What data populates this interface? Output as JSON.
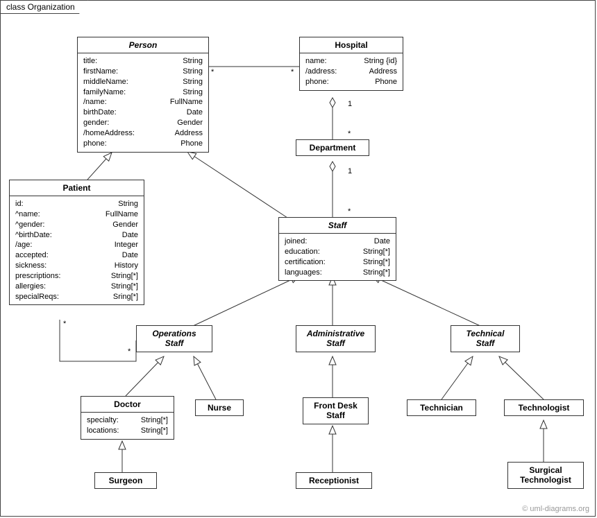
{
  "frame": {
    "title": "class Organization"
  },
  "classes": {
    "person": {
      "name": "Person",
      "attrs": [
        [
          "title:",
          "String"
        ],
        [
          "firstName:",
          "String"
        ],
        [
          "middleName:",
          "String"
        ],
        [
          "familyName:",
          "String"
        ],
        [
          "/name:",
          "FullName"
        ],
        [
          "birthDate:",
          "Date"
        ],
        [
          "gender:",
          "Gender"
        ],
        [
          "/homeAddress:",
          "Address"
        ],
        [
          "phone:",
          "Phone"
        ]
      ]
    },
    "hospital": {
      "name": "Hospital",
      "attrs": [
        [
          "name:",
          "String {id}"
        ],
        [
          "/address:",
          "Address"
        ],
        [
          "phone:",
          "Phone"
        ]
      ]
    },
    "department": {
      "name": "Department"
    },
    "patient": {
      "name": "Patient",
      "attrs": [
        [
          "id:",
          "String"
        ],
        [
          "^name:",
          "FullName"
        ],
        [
          "^gender:",
          "Gender"
        ],
        [
          "^birthDate:",
          "Date"
        ],
        [
          "/age:",
          "Integer"
        ],
        [
          "accepted:",
          "Date"
        ],
        [
          "sickness:",
          "History"
        ],
        [
          "prescriptions:",
          "String[*]"
        ],
        [
          "allergies:",
          "String[*]"
        ],
        [
          "specialReqs:",
          "Sring[*]"
        ]
      ]
    },
    "staff": {
      "name": "Staff",
      "attrs": [
        [
          "joined:",
          "Date"
        ],
        [
          "education:",
          "String[*]"
        ],
        [
          "certification:",
          "String[*]"
        ],
        [
          "languages:",
          "String[*]"
        ]
      ]
    },
    "operationsStaff": {
      "name1": "Operations",
      "name2": "Staff"
    },
    "administrativeStaff": {
      "name1": "Administrative",
      "name2": "Staff"
    },
    "technicalStaff": {
      "name1": "Technical",
      "name2": "Staff"
    },
    "doctor": {
      "name": "Doctor",
      "attrs": [
        [
          "specialty:",
          "String[*]"
        ],
        [
          "locations:",
          "String[*]"
        ]
      ]
    },
    "nurse": {
      "name": "Nurse"
    },
    "frontDeskStaff": {
      "name1": "Front Desk",
      "name2": "Staff"
    },
    "receptionist": {
      "name": "Receptionist"
    },
    "technician": {
      "name": "Technician"
    },
    "technologist": {
      "name": "Technologist"
    },
    "surgicalTechnologist": {
      "name1": "Surgical",
      "name2": "Technologist"
    },
    "surgeon": {
      "name": "Surgeon"
    }
  },
  "mult": {
    "personHospital_left": "*",
    "personHospital_right": "*",
    "hospitalDept_top": "1",
    "hospitalDept_bottom": "*",
    "deptStaff_top": "1",
    "deptStaff_bottom": "*",
    "patientOps_left": "*",
    "patientOps_right": "*"
  },
  "watermark": "© uml-diagrams.org"
}
